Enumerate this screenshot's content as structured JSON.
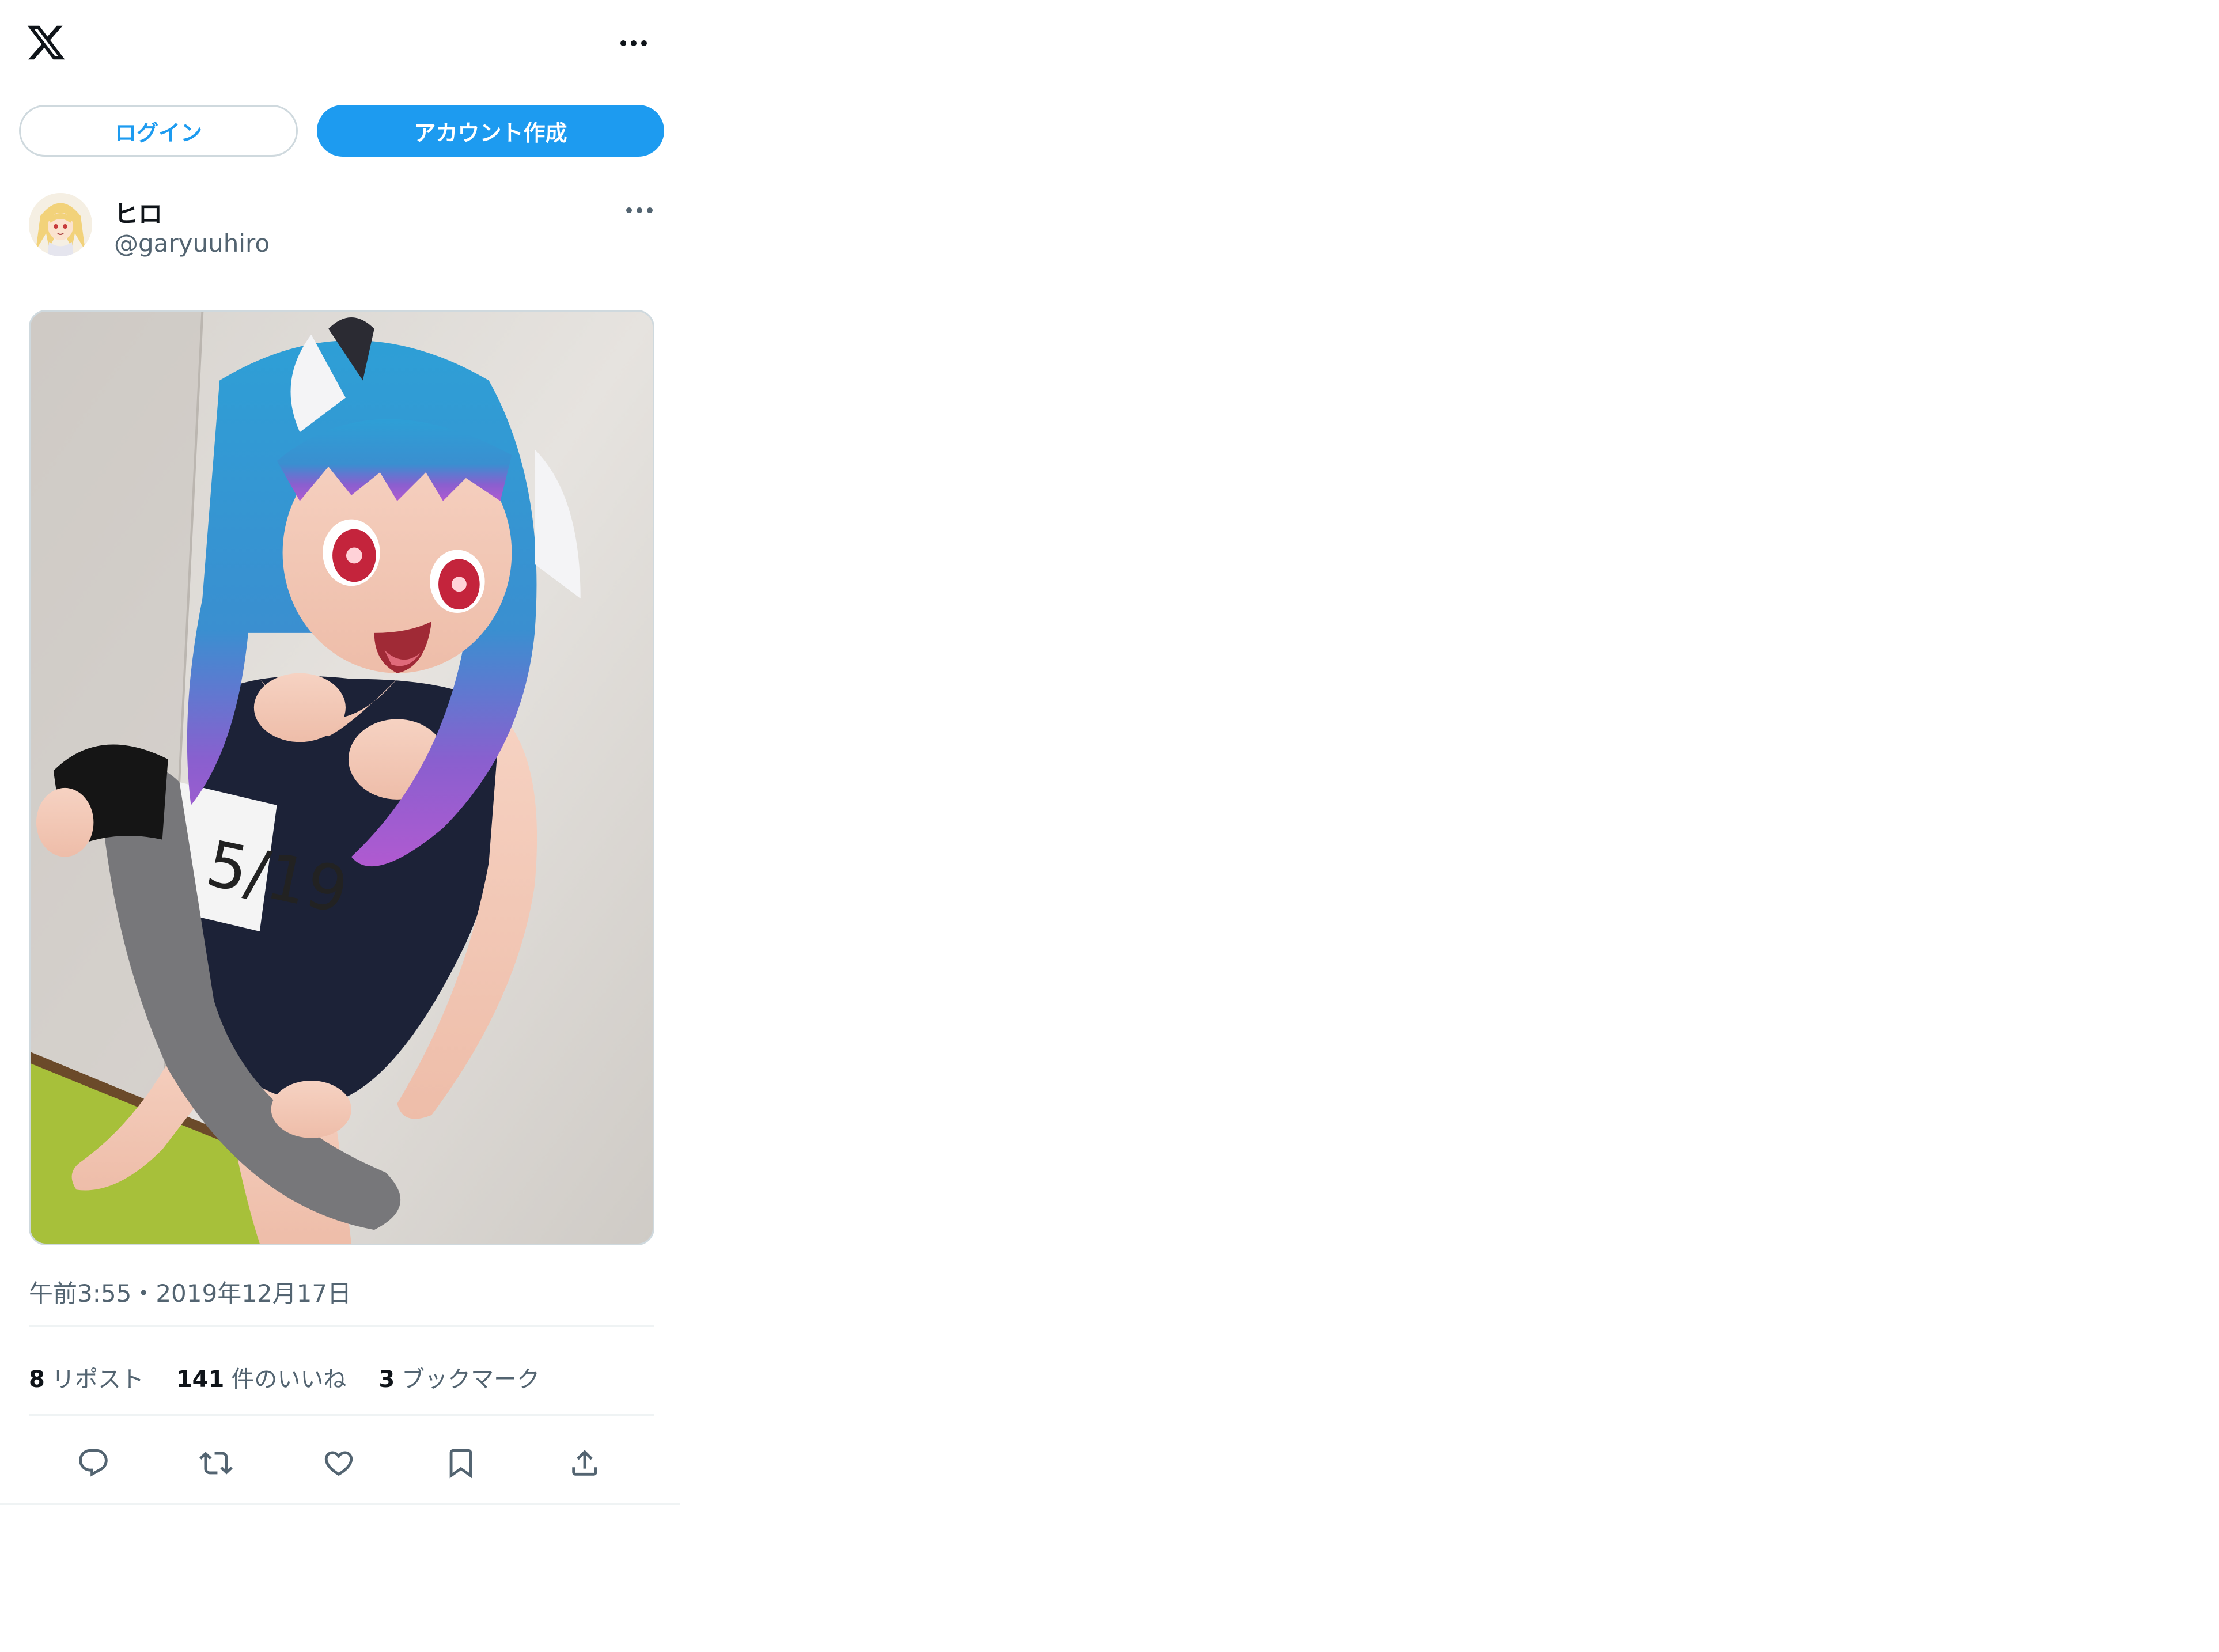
{
  "header": {
    "logo_icon": "x-logo-icon",
    "more_icon": "more-horizontal-icon"
  },
  "auth": {
    "login_label": "ログイン",
    "signup_label": "アカウント作成"
  },
  "tweet": {
    "display_name": "ヒロ",
    "handle": "@garyuuhiro",
    "timestamp": "午前3:55・2019年12月17日",
    "stats": {
      "reposts_count": "8",
      "reposts_label": "リポスト",
      "likes_count": "141",
      "likes_label": "件のいいね",
      "bookmarks_count": "3",
      "bookmarks_label": "ブックマーク"
    },
    "actions": [
      "reply-icon",
      "repost-icon",
      "like-icon",
      "bookmark-icon",
      "share-icon"
    ]
  },
  "colors": {
    "accent": "#1d9bf0",
    "text_primary": "#0f1419",
    "text_secondary": "#536471",
    "border": "#cfd9de"
  }
}
